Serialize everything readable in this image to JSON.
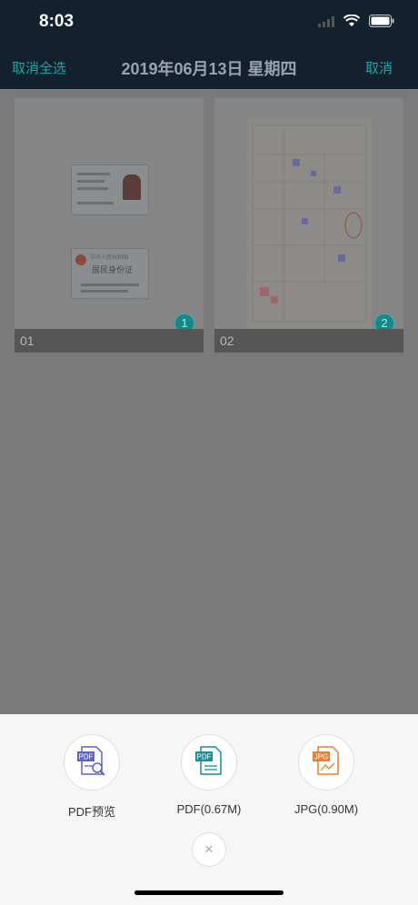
{
  "status": {
    "time": "8:03"
  },
  "nav": {
    "left_label": "取消全选",
    "title": "2019年06月13日 星期四",
    "right_label": "取消"
  },
  "cards": [
    {
      "label": "01",
      "badge": "1",
      "id_card_title": "中华人民共和国",
      "id_card_subtitle": "居民身份证"
    },
    {
      "label": "02",
      "badge": "2"
    }
  ],
  "actions": [
    {
      "label": "PDF预览",
      "icon": "pdf-preview-icon",
      "icon_text": "PDF",
      "color": "#5a64c8"
    },
    {
      "label": "PDF(0.67M)",
      "icon": "pdf-file-icon",
      "icon_text": "PDF",
      "color": "#16909a"
    },
    {
      "label": "JPG(0.90M)",
      "icon": "jpg-file-icon",
      "icon_text": "JPG",
      "color": "#ee7f2d"
    }
  ],
  "close_glyph": "×",
  "colors": {
    "accent": "#1aa6a6",
    "navbar_bg": "#13202d"
  }
}
